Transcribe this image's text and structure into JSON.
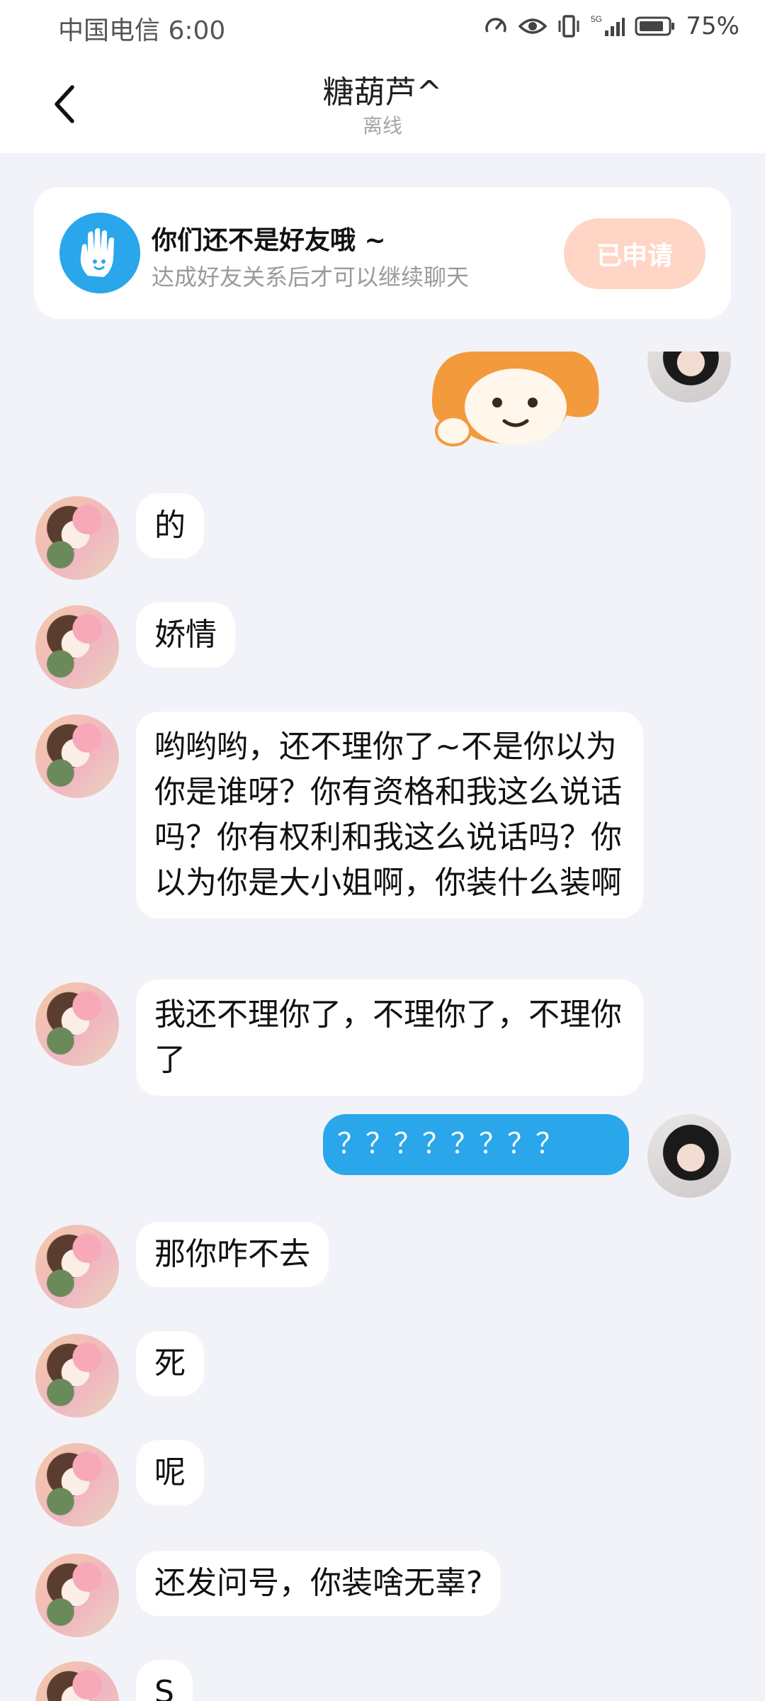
{
  "status_bar": {
    "carrier": "中国电信 6:00",
    "battery": "75%"
  },
  "header": {
    "back_icon": "chevron-left-icon",
    "title": "糖葫芦^",
    "status": "离线"
  },
  "friend_notice": {
    "icon": "hand-icon",
    "title": "你们还不是好友哦 ~",
    "description": "达成好友关系后才可以继续聊天",
    "button_label": "已申请"
  },
  "messages": [
    {
      "side": "in",
      "text": "的"
    },
    {
      "side": "in",
      "text": "娇情"
    },
    {
      "side": "in",
      "text": "哟哟哟，还不理你了~不是你以为你是谁呀？你有资格和我这么说话吗？你有权利和我这么说话吗？你以为你是大小姐啊，你装什么装啊"
    },
    {
      "side": "in",
      "text": "我还不理你了，不理你了，不理你了"
    },
    {
      "side": "out",
      "text": "？？？？？？？？"
    },
    {
      "side": "in",
      "text": "那你咋不去"
    },
    {
      "side": "in",
      "text": "死"
    },
    {
      "side": "in",
      "text": "呢"
    },
    {
      "side": "in",
      "text": "还发问号，你装啥无辜?"
    },
    {
      "side": "in",
      "text": "S"
    }
  ]
}
